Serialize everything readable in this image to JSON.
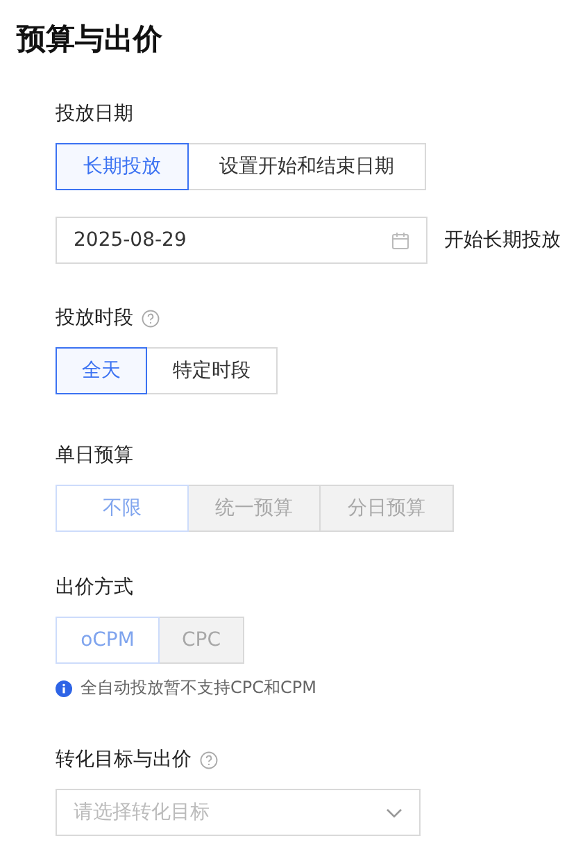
{
  "title": "预算与出价",
  "sections": [
    {
      "label": "投放日期",
      "disabled": false,
      "options": [
        {
          "label": "长期投放",
          "selected": true
        },
        {
          "label": "设置开始和结束日期",
          "selected": false
        }
      ],
      "date": {
        "value": "2025-08-29",
        "note": "开始长期投放"
      }
    },
    {
      "label": "投放时段",
      "help": true,
      "disabled": false,
      "options": [
        {
          "label": "全天",
          "selected": true
        },
        {
          "label": "特定时段",
          "selected": false
        }
      ]
    },
    {
      "label": "单日预算",
      "disabled": true,
      "options": [
        {
          "label": "不限",
          "selected": true
        },
        {
          "label": "统一预算",
          "selected": false
        },
        {
          "label": "分日预算",
          "selected": false
        }
      ]
    },
    {
      "label": "出价方式",
      "disabled": true,
      "options": [
        {
          "label": "oCPM",
          "selected": true
        },
        {
          "label": "CPC",
          "selected": false
        }
      ],
      "note": "全自动投放暂不支持CPC和CPM"
    },
    {
      "label": "转化目标与出价",
      "help": true,
      "select": {
        "placeholder": "请选择转化目标"
      }
    }
  ]
}
